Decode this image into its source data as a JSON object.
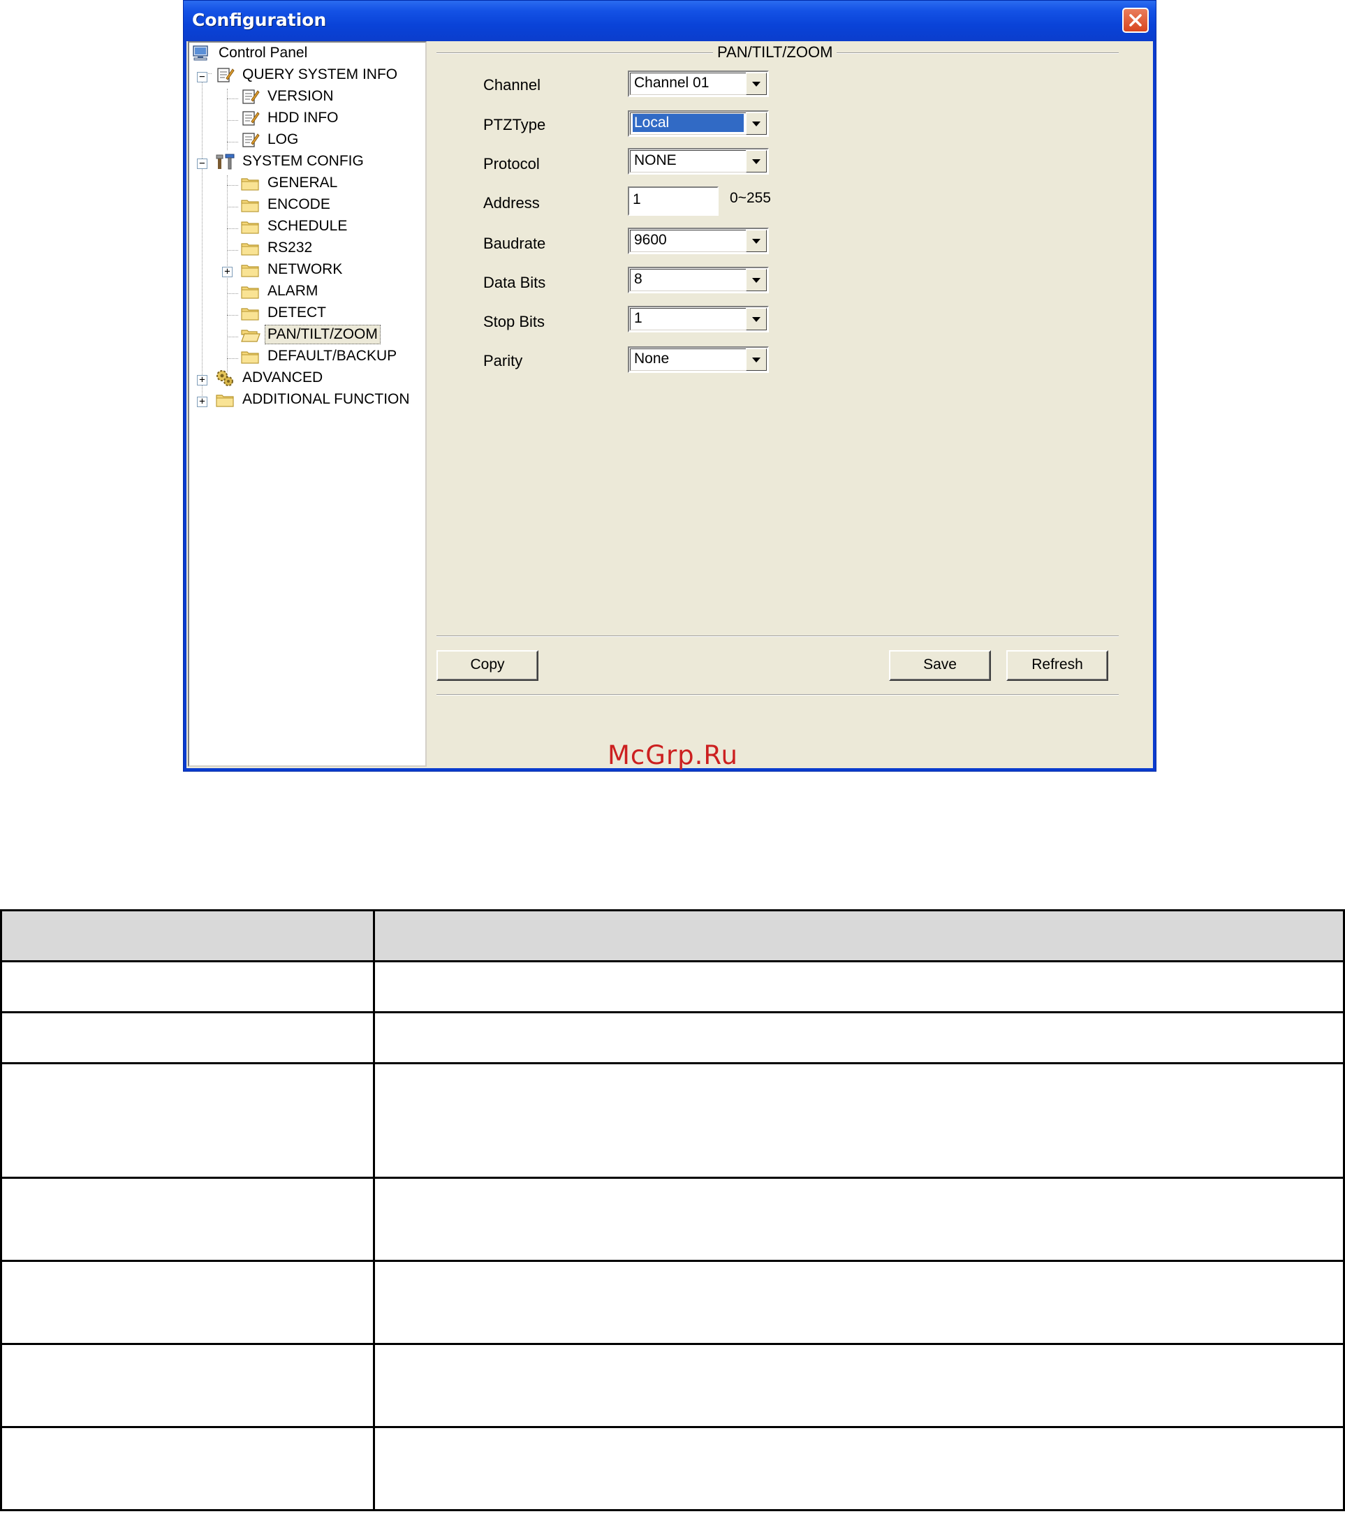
{
  "window": {
    "title": "Configuration",
    "close_icon": "close-icon"
  },
  "tree": {
    "items": [
      {
        "label": "Control Panel",
        "icon": "computer-icon"
      },
      {
        "label": "QUERY SYSTEM INFO",
        "icon": "notepad-icon"
      },
      {
        "label": "VERSION",
        "icon": "notepad-icon"
      },
      {
        "label": "HDD INFO",
        "icon": "notepad-icon"
      },
      {
        "label": "LOG",
        "icon": "notepad-icon"
      },
      {
        "label": "SYSTEM CONFIG",
        "icon": "tools-icon"
      },
      {
        "label": "GENERAL",
        "icon": "folder-icon"
      },
      {
        "label": "ENCODE",
        "icon": "folder-icon"
      },
      {
        "label": "SCHEDULE",
        "icon": "folder-icon"
      },
      {
        "label": "RS232",
        "icon": "folder-icon"
      },
      {
        "label": "NETWORK",
        "icon": "folder-icon"
      },
      {
        "label": "ALARM",
        "icon": "folder-icon"
      },
      {
        "label": "DETECT",
        "icon": "folder-icon"
      },
      {
        "label": "PAN/TILT/ZOOM",
        "icon": "folder-open-icon",
        "selected": true
      },
      {
        "label": "DEFAULT/BACKUP",
        "icon": "folder-icon"
      },
      {
        "label": "ADVANCED",
        "icon": "gears-icon"
      },
      {
        "label": "ADDITIONAL FUNCTION",
        "icon": "folder-icon"
      }
    ]
  },
  "panel": {
    "group_title": "PAN/TILT/ZOOM",
    "fields": {
      "channel": {
        "label": "Channel",
        "value": "Channel 01"
      },
      "ptz_type": {
        "label": "PTZType",
        "value": "Local"
      },
      "protocol": {
        "label": "Protocol",
        "value": "NONE"
      },
      "address": {
        "label": "Address",
        "value": "1",
        "range": "0~255"
      },
      "baudrate": {
        "label": "Baudrate",
        "value": "9600"
      },
      "data_bits": {
        "label": "Data Bits",
        "value": "8"
      },
      "stop_bits": {
        "label": "Stop Bits",
        "value": "1"
      },
      "parity": {
        "label": "Parity",
        "value": "None"
      }
    },
    "buttons": {
      "copy": "Copy",
      "save": "Save",
      "refresh": "Refresh"
    }
  },
  "watermark": "McGrp.Ru",
  "doc_table": {
    "columns": [
      "",
      ""
    ],
    "rows": [
      [
        "",
        ""
      ],
      [
        "",
        ""
      ],
      [
        "",
        ""
      ],
      [
        "",
        ""
      ],
      [
        "",
        ""
      ],
      [
        "",
        ""
      ],
      [
        "",
        ""
      ]
    ]
  }
}
